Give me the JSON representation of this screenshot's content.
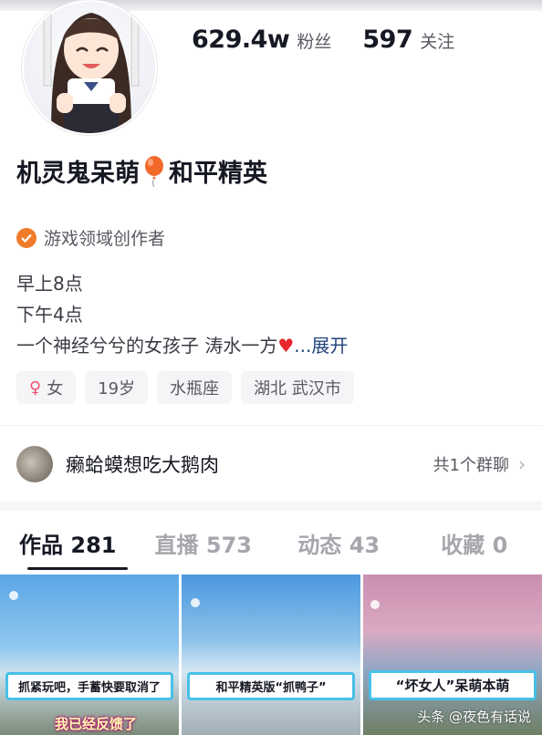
{
  "profile": {
    "followers_count": "629.4w",
    "followers_label": "粉丝",
    "following_count": "597",
    "following_label": "关注",
    "nickname_part1": "机灵鬼呆萌",
    "nickname_part2": "和平精英",
    "certification": "游戏领域创作者",
    "bio_lines": [
      "早上8点",
      "下午4点",
      "一个神经兮兮的女孩子 涛水一方"
    ],
    "bio_expand": "...展开",
    "tags": {
      "gender": "女",
      "age": "19岁",
      "zodiac": "水瓶座",
      "location": "湖北 武汉市"
    }
  },
  "group": {
    "name": "癞蛤蟆想吃大鹅肉",
    "count_label": "共1个群聊"
  },
  "tabs": [
    {
      "label": "作品 281"
    },
    {
      "label": "直播 573"
    },
    {
      "label": "动态 43"
    },
    {
      "label": "收藏 0"
    }
  ],
  "videos": [
    {
      "caption": "抓紧玩吧，手蓄快要取消了",
      "sticker": "我已经反馈了"
    },
    {
      "caption": "和平精英版“抓鸭子”"
    },
    {
      "caption": "“坏女人”呆萌本萌"
    }
  ],
  "watermark": "头条 @夜色有话说",
  "colors": {
    "accent_orange": "#f07c2b",
    "heart_red": "#e8262e",
    "expand_link": "#22457e",
    "caption_border": "#48c0e8"
  }
}
